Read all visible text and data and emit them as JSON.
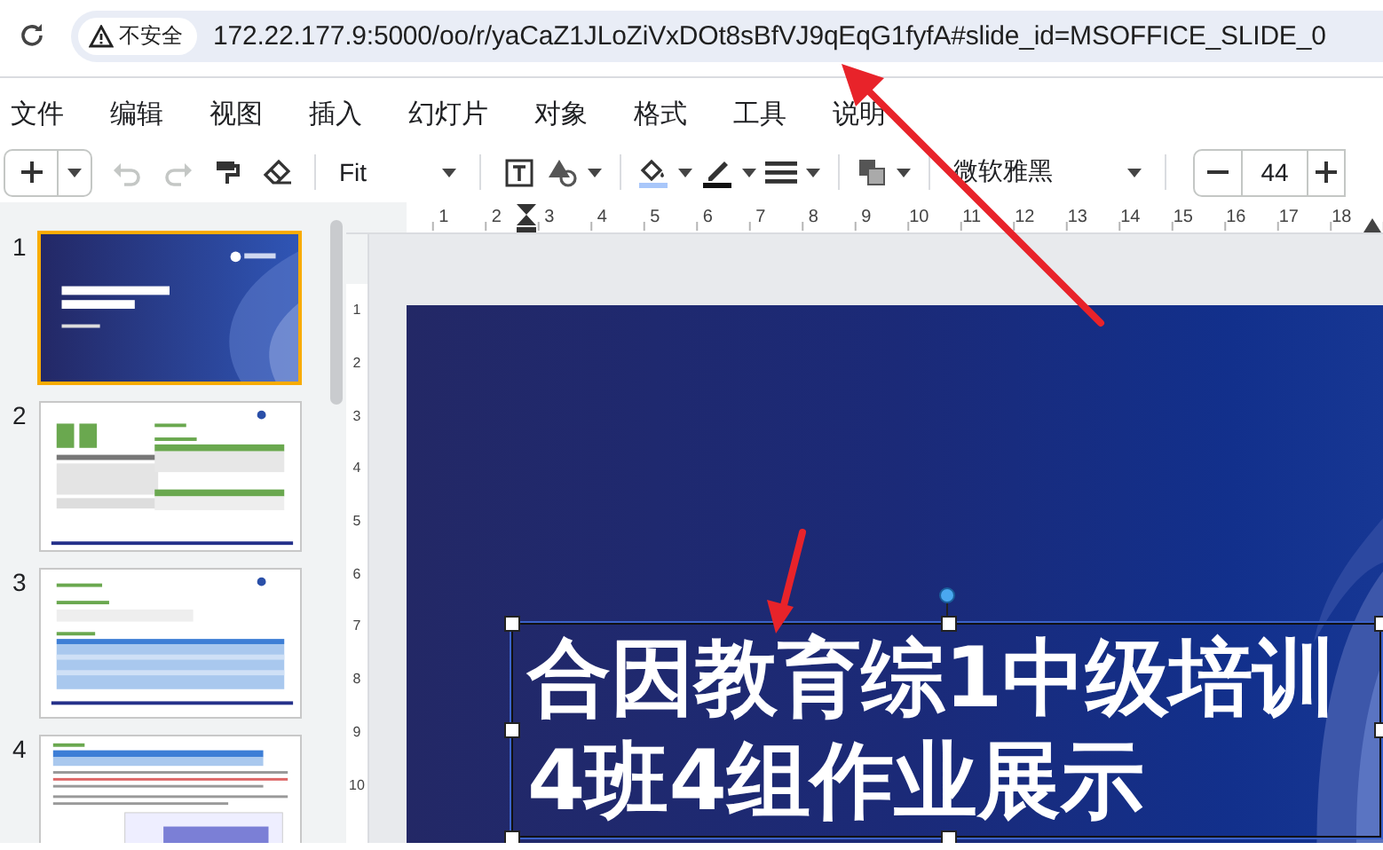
{
  "browser": {
    "security_label": "不安全",
    "url": "172.22.177.9:5000/oo/r/yaCaZ1JLoZiVxDOt8sBfVJ9qEqG1fyfA#slide_id=MSOFFICE_SLIDE_0"
  },
  "menu": [
    "文件",
    "编辑",
    "视图",
    "插入",
    "幻灯片",
    "对象",
    "格式",
    "工具",
    "说明"
  ],
  "toolbar": {
    "history_buttons": [
      {
        "kind": "undo",
        "disabled": true
      },
      {
        "kind": "redo",
        "disabled": true
      }
    ],
    "zoom": "Fit",
    "font": "微软雅黑",
    "font_size": "44"
  },
  "rulers": {
    "horizontal": [
      "1",
      "2",
      "3",
      "4",
      "5",
      "6",
      "7",
      "8",
      "9",
      "10",
      "11",
      "12",
      "13",
      "14",
      "15",
      "16",
      "17",
      "18"
    ],
    "vertical": [
      "1",
      "2",
      "3",
      "4",
      "5",
      "6",
      "7",
      "8",
      "9",
      "10"
    ]
  },
  "slides": [
    {
      "number": "1",
      "kind": "title",
      "selected": true
    },
    {
      "number": "2",
      "kind": "green-tables",
      "selected": false
    },
    {
      "number": "3",
      "kind": "blue-table",
      "selected": false
    },
    {
      "number": "4",
      "kind": "text-table",
      "selected": false
    }
  ],
  "current_slide": {
    "title": "合因教育综1中级培训\n4班4组作业展示"
  }
}
